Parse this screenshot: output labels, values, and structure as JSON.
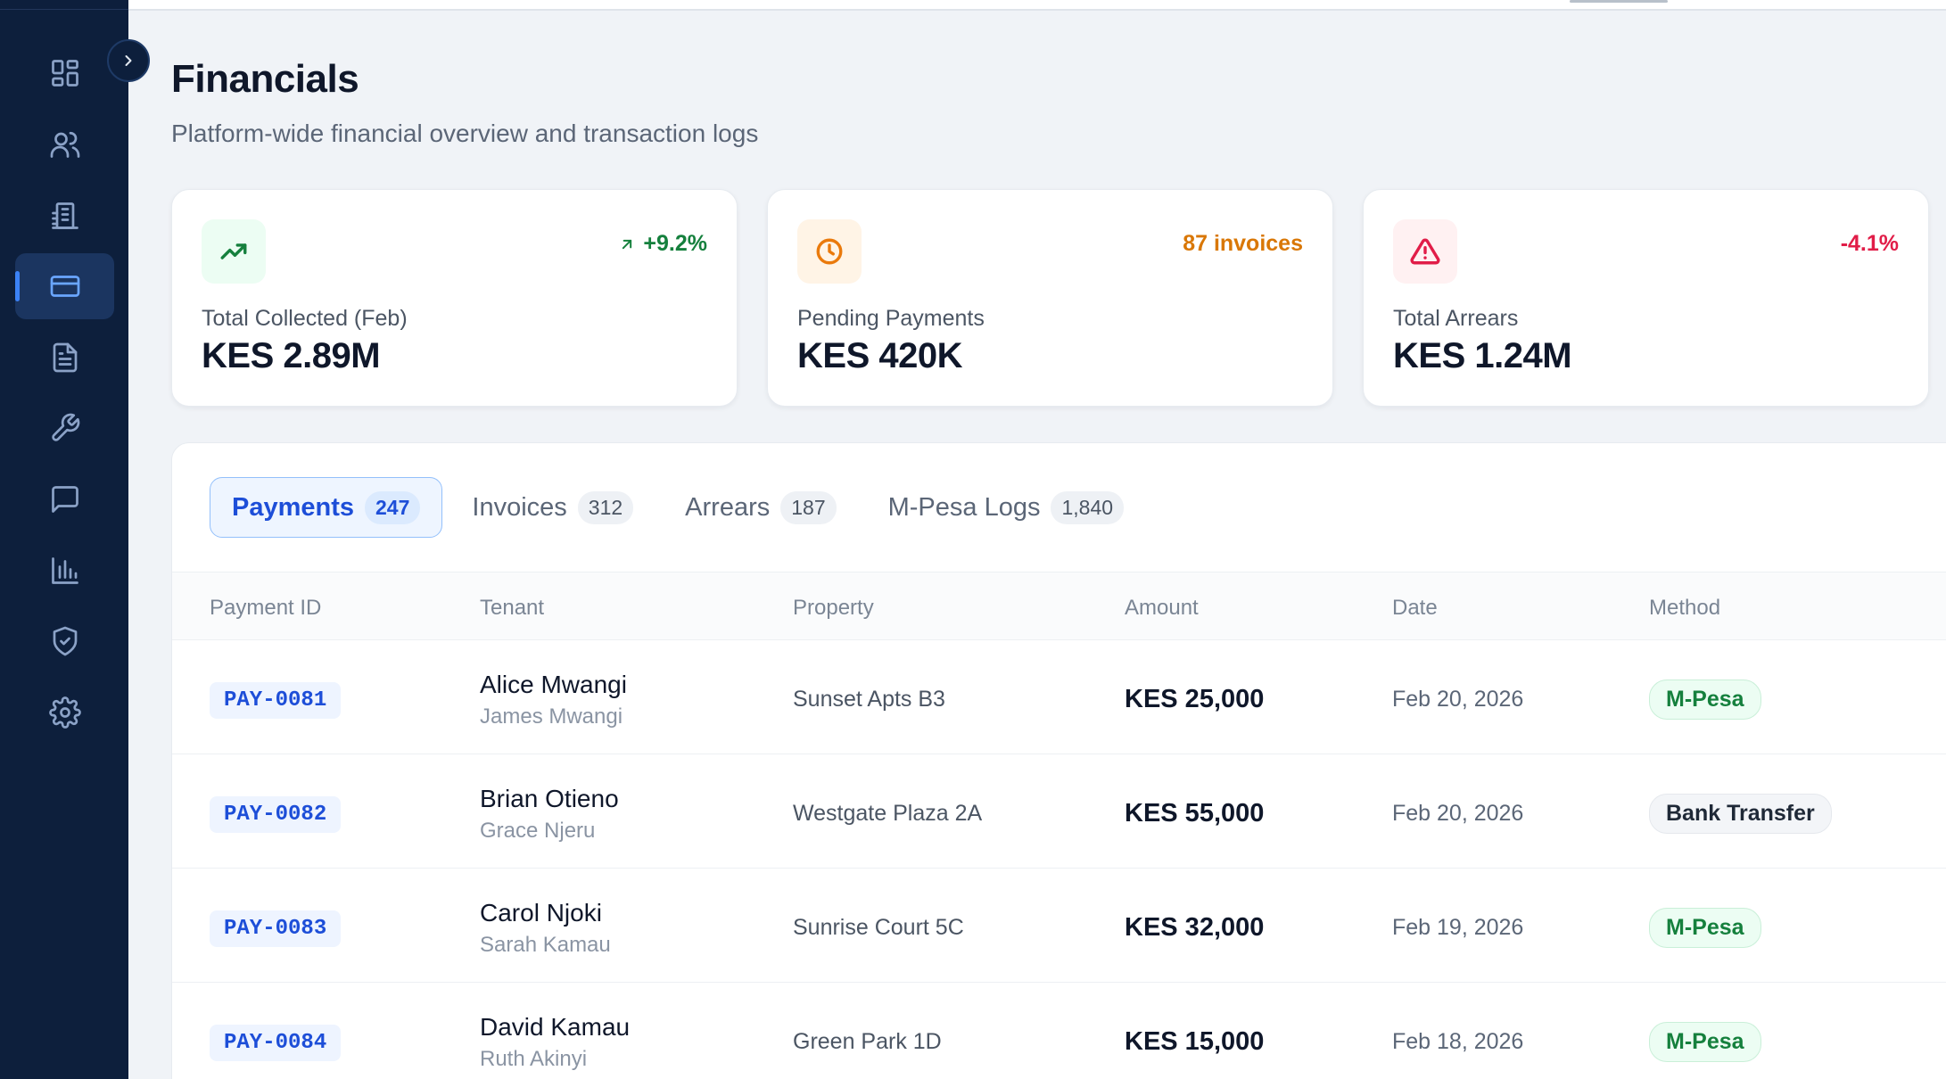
{
  "sidebar": {
    "items": [
      {
        "icon": "dashboard-icon"
      },
      {
        "icon": "users-icon"
      },
      {
        "icon": "building-icon"
      },
      {
        "icon": "credit-card-icon",
        "active": true
      },
      {
        "icon": "document-icon"
      },
      {
        "icon": "wrench-icon"
      },
      {
        "icon": "message-icon"
      },
      {
        "icon": "bar-chart-icon"
      },
      {
        "icon": "shield-check-icon"
      },
      {
        "icon": "gear-icon"
      }
    ]
  },
  "header": {
    "title": "Financials",
    "subtitle": "Platform-wide financial overview and transaction logs"
  },
  "cards": [
    {
      "label": "Total Collected (Feb)",
      "value": "KES 2.89M",
      "trend": "+9.2%",
      "trend_color": "#15803d",
      "icon": "trending-up-icon",
      "icon_bg": "#ecfdf3",
      "icon_color": "#15803d"
    },
    {
      "label": "Pending Payments",
      "value": "KES 420K",
      "trend": "87 invoices",
      "trend_color": "#d97706",
      "icon": "clock-icon",
      "icon_bg": "#fff4e6",
      "icon_color": "#ea7a0c"
    },
    {
      "label": "Total Arrears",
      "value": "KES 1.24M",
      "trend": "-4.1%",
      "trend_color": "#e11d48",
      "icon": "alert-triangle-icon",
      "icon_bg": "#fff1f2",
      "icon_color": "#e11d48"
    }
  ],
  "tabs": [
    {
      "label": "Payments",
      "count": "247",
      "active": true
    },
    {
      "label": "Invoices",
      "count": "312"
    },
    {
      "label": "Arrears",
      "count": "187"
    },
    {
      "label": "M-Pesa Logs",
      "count": "1,840"
    }
  ],
  "table": {
    "columns": [
      "Payment ID",
      "Tenant",
      "Property",
      "Amount",
      "Date",
      "Method"
    ],
    "rows": [
      {
        "id": "PAY-0081",
        "tenant": "Alice Mwangi",
        "tenant_sub": "James Mwangi",
        "property": "Sunset Apts B3",
        "amount": "KES 25,000",
        "date": "Feb 20, 2026",
        "method": "M-Pesa"
      },
      {
        "id": "PAY-0082",
        "tenant": "Brian Otieno",
        "tenant_sub": "Grace Njeru",
        "property": "Westgate Plaza 2A",
        "amount": "KES 55,000",
        "date": "Feb 20, 2026",
        "method": "Bank Transfer"
      },
      {
        "id": "PAY-0083",
        "tenant": "Carol Njoki",
        "tenant_sub": "Sarah Kamau",
        "property": "Sunrise Court 5C",
        "amount": "KES 32,000",
        "date": "Feb 19, 2026",
        "method": "M-Pesa"
      },
      {
        "id": "PAY-0084",
        "tenant": "David Kamau",
        "tenant_sub": "Ruth Akinyi",
        "property": "Green Park 1D",
        "amount": "KES 15,000",
        "date": "Feb 18, 2026",
        "method": "M-Pesa"
      }
    ]
  }
}
